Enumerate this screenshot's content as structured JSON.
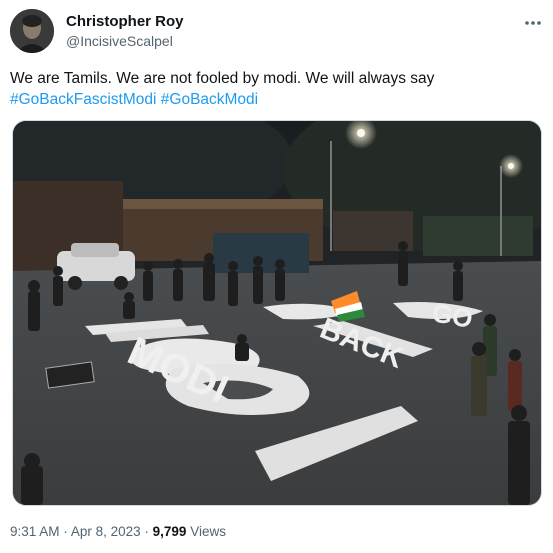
{
  "author": {
    "name": "Christopher Roy",
    "handle": "@IncisiveScalpel"
  },
  "tweet": {
    "text": "We are Tamils. We are not fooled by modi. We will always say",
    "hashtags": [
      "#GoBackFascistModi",
      "#GoBackModi"
    ]
  },
  "media": {
    "road_text": [
      "GO",
      "BACK",
      "MODI"
    ]
  },
  "meta": {
    "time": "9:31 AM",
    "separator": "·",
    "date": "Apr 8, 2023",
    "views_count": "9,799",
    "views_label": "Views"
  },
  "icons": {
    "more": "more-horizontal-icon"
  }
}
